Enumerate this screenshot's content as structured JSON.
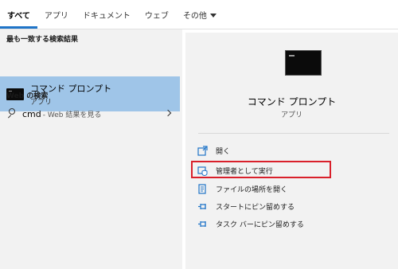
{
  "tabs": [
    {
      "label": "すべて"
    },
    {
      "label": "アプリ"
    },
    {
      "label": "ドキュメント"
    },
    {
      "label": "ウェブ"
    },
    {
      "label": "その他"
    }
  ],
  "left": {
    "best_match_header": "最も一致する検索結果",
    "best_match": {
      "title": "コマンド プロンプト",
      "subtitle": "アプリ"
    },
    "web_header": "Web の検索",
    "web_item": {
      "query": "cmd",
      "suffix": "- Web 結果を見る"
    }
  },
  "right": {
    "app_title": "コマンド プロンプト",
    "app_subtitle": "アプリ",
    "actions": [
      {
        "label": "開く",
        "icon": "open-icon"
      },
      {
        "label": "管理者として実行",
        "icon": "shield-icon"
      },
      {
        "label": "ファイルの場所を開く",
        "icon": "file-location-icon"
      },
      {
        "label": "スタートにピン留めする",
        "icon": "pin-icon"
      },
      {
        "label": "タスク バーにピン留めする",
        "icon": "pin-icon"
      }
    ]
  },
  "colors": {
    "accent": "#1f74c8",
    "selected_background": "#9fc5e8",
    "pane_background": "#f2f2f2",
    "highlight_border": "#d9202b"
  }
}
